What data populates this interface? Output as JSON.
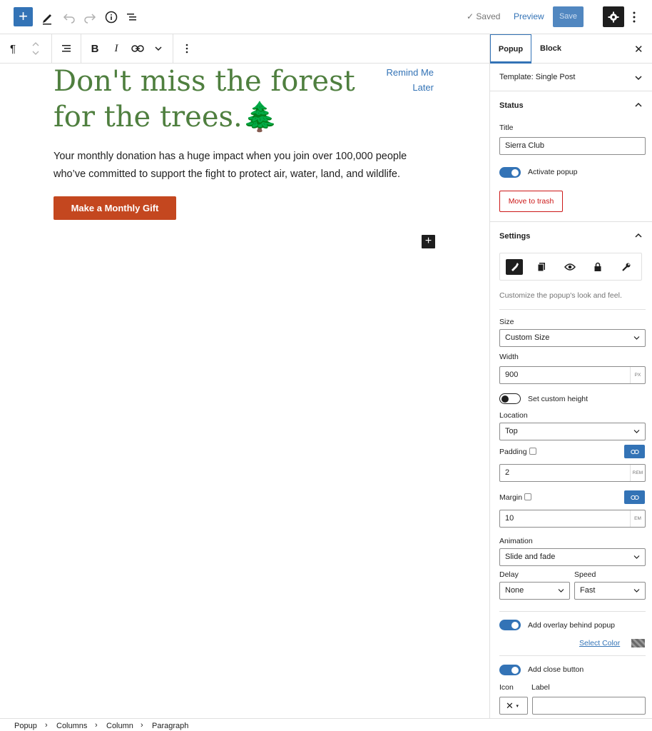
{
  "topbar": {
    "saved_label": "Saved",
    "preview_label": "Preview",
    "save_label": "Save"
  },
  "editor": {
    "headline": "Don't miss the forest for the trees.🌲",
    "remind_line1": "Remind Me",
    "remind_line2": "Later",
    "body_line1": "Your monthly donation has a huge impact when you join over 100,000 people",
    "body_line2": "who’ve committed to support the fight to protect air, water, land, and wildlife.",
    "cta_label": "Make a Monthly Gift"
  },
  "sidebar": {
    "tabs": [
      "Popup",
      "Block"
    ],
    "template_label": "Template: Single Post",
    "status": {
      "heading": "Status",
      "title_label": "Title",
      "title_value": "Sierra Club",
      "activate_label": "Activate popup",
      "trash_label": "Move to trash"
    },
    "settings": {
      "heading": "Settings",
      "help_text": "Customize the popup's look and feel.",
      "size_label": "Size",
      "size_value": "Custom Size",
      "width_label": "Width",
      "width_value": "900",
      "width_unit": "PX",
      "custom_height_label": "Set custom height",
      "location_label": "Location",
      "location_value": "Top",
      "padding_label": "Padding",
      "padding_value": "2",
      "padding_unit": "REM",
      "margin_label": "Margin",
      "margin_value": "10",
      "margin_unit": "EM",
      "animation_label": "Animation",
      "animation_value": "Slide and fade",
      "delay_label": "Delay",
      "delay_value": "None",
      "speed_label": "Speed",
      "speed_value": "Fast",
      "overlay_label": "Add overlay behind popup",
      "select_color_label": "Select Color",
      "close_button_label": "Add close button",
      "icon_label": "Icon",
      "label_label": "Label",
      "icon_value": "✕"
    }
  },
  "breadcrumb": [
    "Popup",
    "Columns",
    "Column",
    "Paragraph"
  ],
  "colors": {
    "accent": "#3373b6",
    "headline": "#4f7f3f",
    "cta": "#c4471f",
    "trash": "#cc1818"
  }
}
